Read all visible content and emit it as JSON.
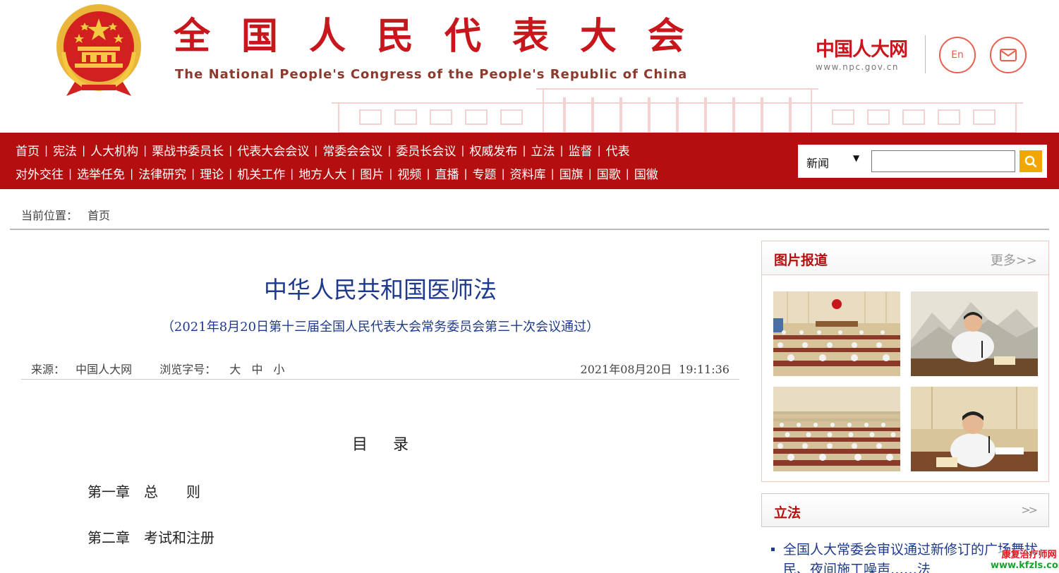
{
  "header": {
    "title_cn": "全国人民代表大会",
    "title_en": "The National People's Congress of the People's Republic of China",
    "site_logo_cn": "中国人大网",
    "site_logo_url": "www.npc.gov.cn",
    "en_label": "En",
    "mail_icon": "mail-icon",
    "emblem_icon": "national-emblem-icon"
  },
  "nav": {
    "row1": [
      "首页",
      "宪法",
      "人大机构",
      "栗战书委员长",
      "代表大会会议",
      "常委会会议",
      "委员长会议",
      "权威发布",
      "立法",
      "监督",
      "代表"
    ],
    "row2": [
      "对外交往",
      "选举任免",
      "法律研究",
      "理论",
      "机关工作",
      "地方人大",
      "图片",
      "视频",
      "直播",
      "专题",
      "资料库",
      "国旗",
      "国歌",
      "国徽"
    ],
    "separator": "|"
  },
  "search": {
    "category": "新闻",
    "arrow": "▼",
    "value": "",
    "button_icon": "search-icon"
  },
  "breadcrumb": {
    "label": "当前位置：",
    "home": "首页"
  },
  "article": {
    "title": "中华人民共和国医师法",
    "subtitle": "（2021年8月20日第十三届全国人民代表大会常务委员会第三十次会议通过）",
    "source_label": "来源：",
    "source": "中国人大网",
    "fontsize_label": "浏览字号：",
    "fontsize_large": "大",
    "fontsize_medium": "中",
    "fontsize_small": "小",
    "date": "2021年08月20日  19:11:36",
    "toc_title": "目录",
    "chapters": [
      "第一章　总　　则",
      "第二章　考试和注册"
    ]
  },
  "picture_news": {
    "title": "图片报道",
    "more": "更多>>"
  },
  "legislation": {
    "title": "立法",
    "more": ">>",
    "item": "全国人大常委会审议通过新修订的广场舞扰民、夜间施工噪声……法"
  },
  "watermark": {
    "line1": "康复治疗师网",
    "line2": "www.kfzls.com"
  },
  "colors": {
    "brand_red": "#c8161d",
    "nav_bg": "#b50e0e",
    "link_blue": "#1f3a8c",
    "search_btn": "#f0a800"
  }
}
